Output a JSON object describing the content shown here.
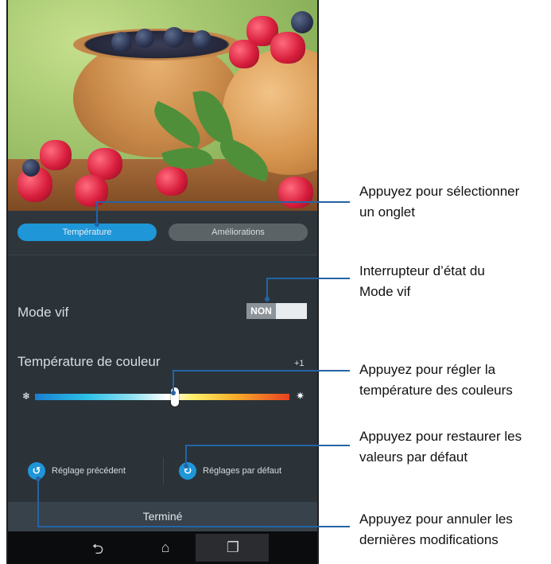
{
  "tabs": {
    "active_label": "Température",
    "inactive_label": "Améliorations"
  },
  "mode_vif": {
    "label": "Mode vif",
    "toggle_state": "NON"
  },
  "color_temperature": {
    "label": "Température de couleur",
    "value": "+1",
    "slider_level": 0.55
  },
  "actions": {
    "previous_label": "Réglage précédent",
    "default_label": "Réglages par défaut"
  },
  "done_label": "Terminé",
  "nav_icons": [
    "back-icon",
    "home-icon",
    "recent-apps-icon"
  ],
  "callouts": {
    "tab": [
      "Appuyez pour sélectionner",
      "un onglet"
    ],
    "toggle": [
      "Interrupteur d’état du",
      "Mode vif"
    ],
    "slider": [
      "Appuyez pour régler la",
      "température des couleurs"
    ],
    "defaults": [
      "Appuyez pour restaurer les",
      "valeurs par défaut"
    ],
    "undo": [
      "Appuyez pour annuler les",
      "dernières modifications"
    ]
  },
  "colors": {
    "accent": "#1f96d8",
    "panel": "#2b3339",
    "callout_line": "#2563a6"
  }
}
